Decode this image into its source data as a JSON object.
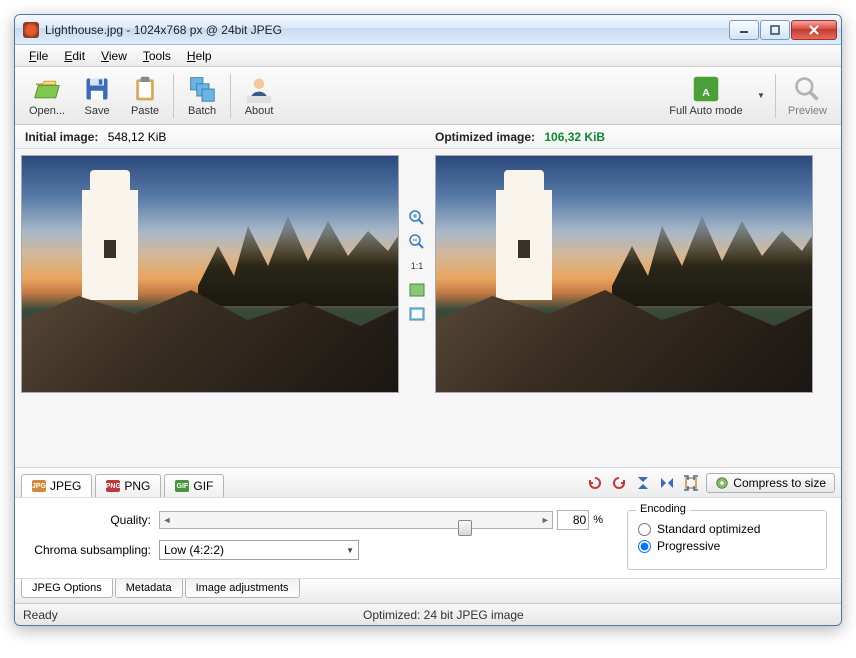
{
  "titlebar": {
    "text": "Lighthouse.jpg - 1024x768 px @ 24bit JPEG"
  },
  "menu": {
    "file": "File",
    "edit": "Edit",
    "view": "View",
    "tools": "Tools",
    "help": "Help"
  },
  "toolbar": {
    "open": "Open...",
    "save": "Save",
    "paste": "Paste",
    "batch": "Batch",
    "about": "About",
    "automode": "Full Auto mode",
    "preview": "Preview"
  },
  "sizes": {
    "initial_label": "Initial image:",
    "initial_value": "548,12 KiB",
    "optimized_label": "Optimized image:",
    "optimized_value": "106,32 KiB"
  },
  "midtools": {
    "ratio": "1:1"
  },
  "formattabs": {
    "jpeg": "JPEG",
    "png": "PNG",
    "gif": "GIF"
  },
  "compress_label": "Compress to size",
  "options": {
    "quality_label": "Quality:",
    "quality_value": "80",
    "pct": "%",
    "chroma_label": "Chroma subsampling:",
    "chroma_value": "Low (4:2:2)",
    "encoding_legend": "Encoding",
    "encoding_standard": "Standard optimized",
    "encoding_progressive": "Progressive"
  },
  "bottomtabs": {
    "jpeg": "JPEG Options",
    "metadata": "Metadata",
    "adjust": "Image adjustments"
  },
  "status": {
    "ready": "Ready",
    "optimized": "Optimized: 24 bit JPEG image"
  }
}
